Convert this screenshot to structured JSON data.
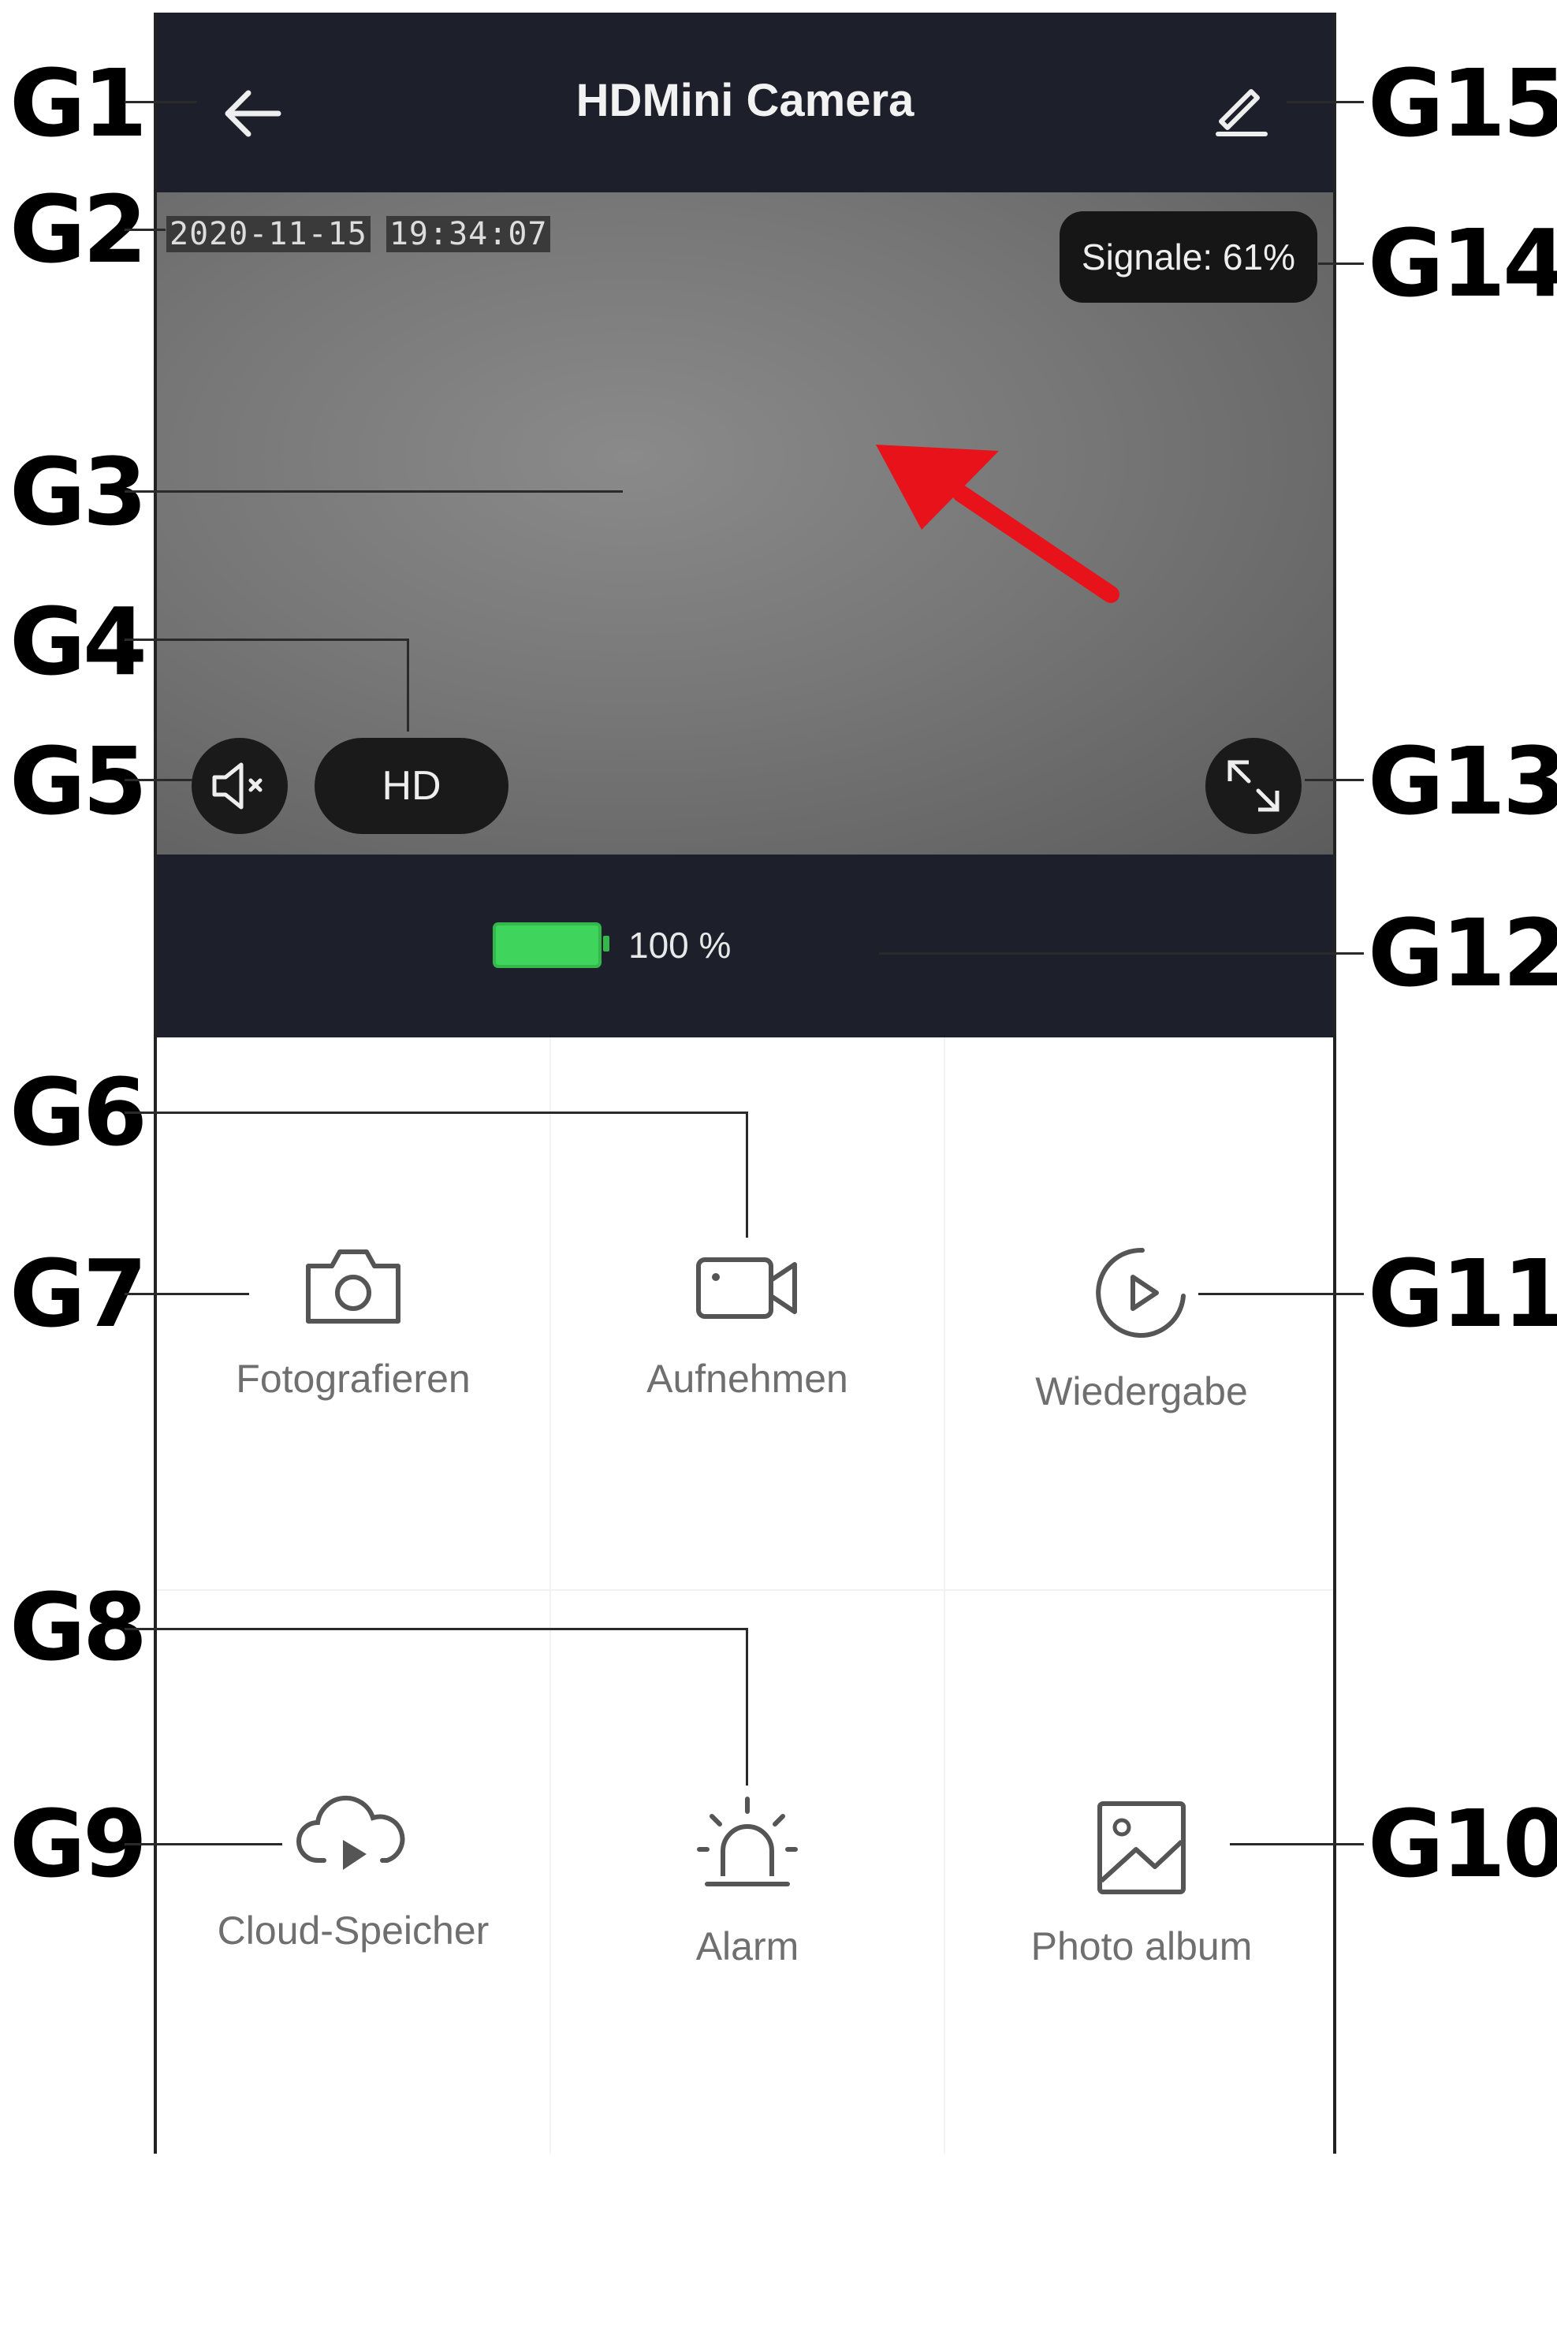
{
  "app": {
    "title": "HDMini Camera"
  },
  "video": {
    "date": "2020-11-15",
    "time": "19:34:07",
    "signal": "Signale: 61%",
    "quality_label": "HD"
  },
  "status": {
    "battery_text": "100 %",
    "battery_level": 1.0
  },
  "actions": [
    {
      "label": "Fotografieren",
      "icon": "camera-icon"
    },
    {
      "label": "Aufnehmen",
      "icon": "video-camera-icon"
    },
    {
      "label": "Wiedergabe",
      "icon": "playback-icon"
    },
    {
      "label": "Cloud-Speicher",
      "icon": "cloud-play-icon"
    },
    {
      "label": "Alarm",
      "icon": "alarm-siren-icon"
    },
    {
      "label": "Photo album",
      "icon": "photo-album-icon"
    }
  ],
  "callouts": [
    "G1",
    "G2",
    "G3",
    "G4",
    "G5",
    "G6",
    "G7",
    "G8",
    "G9",
    "G10",
    "G11",
    "G12",
    "G13",
    "G14",
    "G15"
  ],
  "colors": {
    "header_bg": "#1d1f2a",
    "battery_green": "#3fd45c",
    "arrow_red": "#e8131a"
  }
}
